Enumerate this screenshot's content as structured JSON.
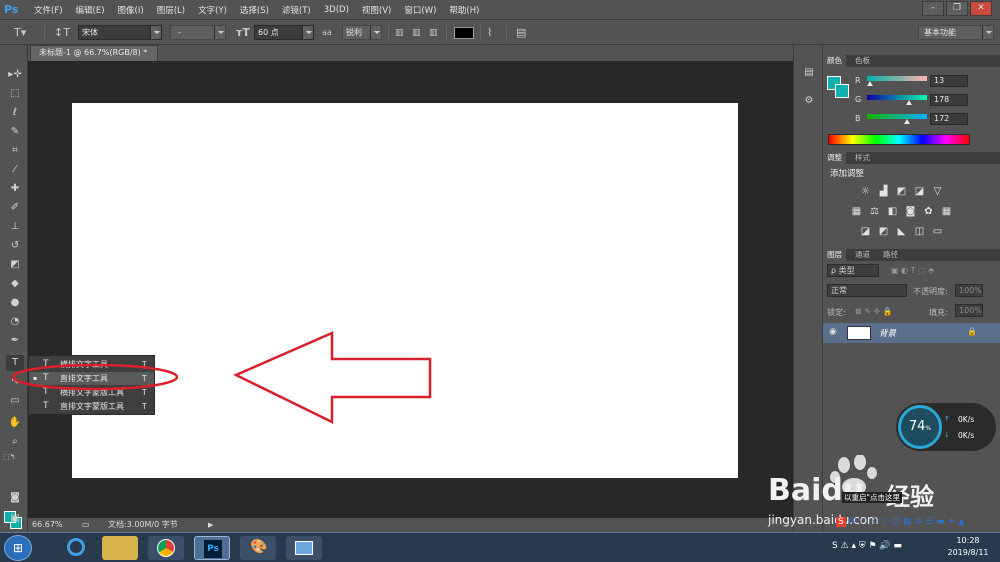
{
  "app": {
    "logo": "Ps"
  },
  "menu": [
    "文件(F)",
    "编辑(E)",
    "图像(I)",
    "图层(L)",
    "文字(Y)",
    "选择(S)",
    "滤镜(T)",
    "3D(D)",
    "视图(V)",
    "窗口(W)",
    "帮助(H)"
  ],
  "options": {
    "font_family": "宋体",
    "font_style": "-",
    "font_size": "60 点",
    "antialias_prefix": "aa",
    "antialias": "锐利",
    "text_color": "#000000",
    "workspace": "基本功能"
  },
  "document": {
    "tab_title": "未标题-1 @ 66.7%(RGB/8) *"
  },
  "flyout": [
    {
      "label": "横排文字工具",
      "key": "T",
      "icon": "T"
    },
    {
      "label": "直排文字工具",
      "key": "T",
      "icon": "T"
    },
    {
      "label": "横排文字蒙版工具",
      "key": "T",
      "icon": "T"
    },
    {
      "label": "直排文字蒙版工具",
      "key": "T",
      "icon": "T"
    }
  ],
  "status": {
    "zoom": "66.67%",
    "doc_info": "文档:3.00M/0 字节"
  },
  "color_panel": {
    "tabs": [
      "颜色",
      "色板"
    ],
    "r_label": "R",
    "g_label": "G",
    "b_label": "B",
    "r": "13",
    "g": "178",
    "b": "172",
    "r_level": 13,
    "g_level": 178,
    "b_level": 172,
    "fg": "#0db2ac"
  },
  "adjust_panel": {
    "tabs": [
      "调整",
      "样式"
    ],
    "heading": "添加调整"
  },
  "layers_panel": {
    "tabs": [
      "图层",
      "通道",
      "路径"
    ],
    "filter": "ρ 类型",
    "blend_mode": "正常",
    "opacity_label": "不透明度:",
    "opacity": "100%",
    "lock_label": "锁定:",
    "fill_label": "填充:",
    "fill": "100%",
    "layers": [
      {
        "name": "背景"
      }
    ]
  },
  "net_widget": {
    "percent": "74",
    "unit": "%",
    "up": "0K/s",
    "down": "0K/s"
  },
  "watermark": {
    "brand": "Baidu",
    "cn": "经验",
    "site": "jingyan.baidu.com",
    "tip": "以重启\"点击这里"
  },
  "clock": {
    "time": "10:28",
    "date": "2019/8/11"
  }
}
